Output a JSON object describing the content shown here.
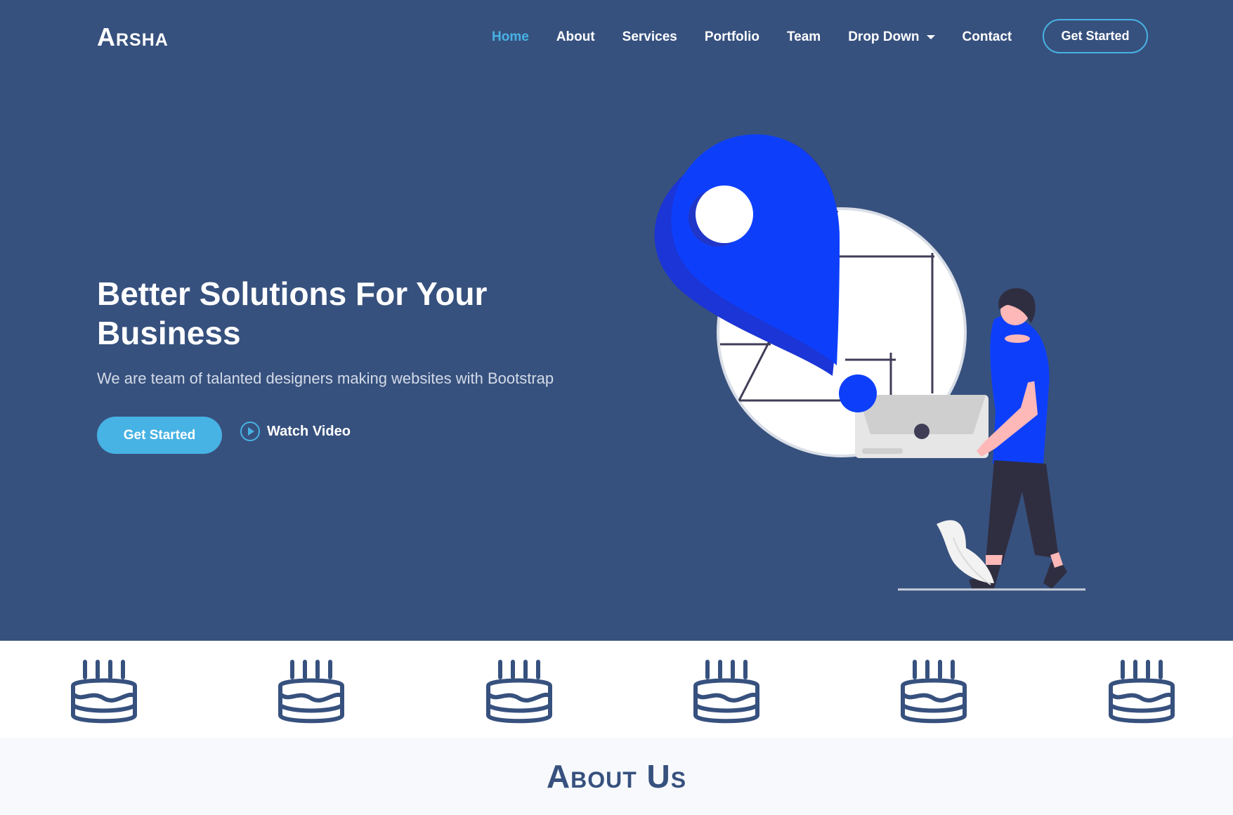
{
  "brand": {
    "logo_text": "Arsha"
  },
  "nav": {
    "items": [
      {
        "label": "Home",
        "active": true
      },
      {
        "label": "About"
      },
      {
        "label": "Services"
      },
      {
        "label": "Portfolio"
      },
      {
        "label": "Team"
      },
      {
        "label": "Drop Down",
        "has_dropdown": true
      },
      {
        "label": "Contact"
      }
    ],
    "cta_label": "Get Started"
  },
  "hero": {
    "title_line1": "Better Solutions For Your",
    "title_line2": "Business",
    "subtitle": "We are team of talanted designers making websites with Bootstrap",
    "primary_button": "Get Started",
    "video_link": "Watch Video",
    "video_icon": "play-circle-icon",
    "illustration": "person-with-map-pin-illustration"
  },
  "clients": {
    "logos": [
      "birthday-cake-icon",
      "birthday-cake-icon",
      "birthday-cake-icon",
      "birthday-cake-icon",
      "birthday-cake-icon",
      "birthday-cake-icon"
    ]
  },
  "about": {
    "title": "About Us"
  },
  "colors": {
    "hero_bg": "#37517e",
    "accent": "#47b2e4",
    "pin_blue": "#0d3ffb",
    "page_bg": "#f7f9fc"
  }
}
